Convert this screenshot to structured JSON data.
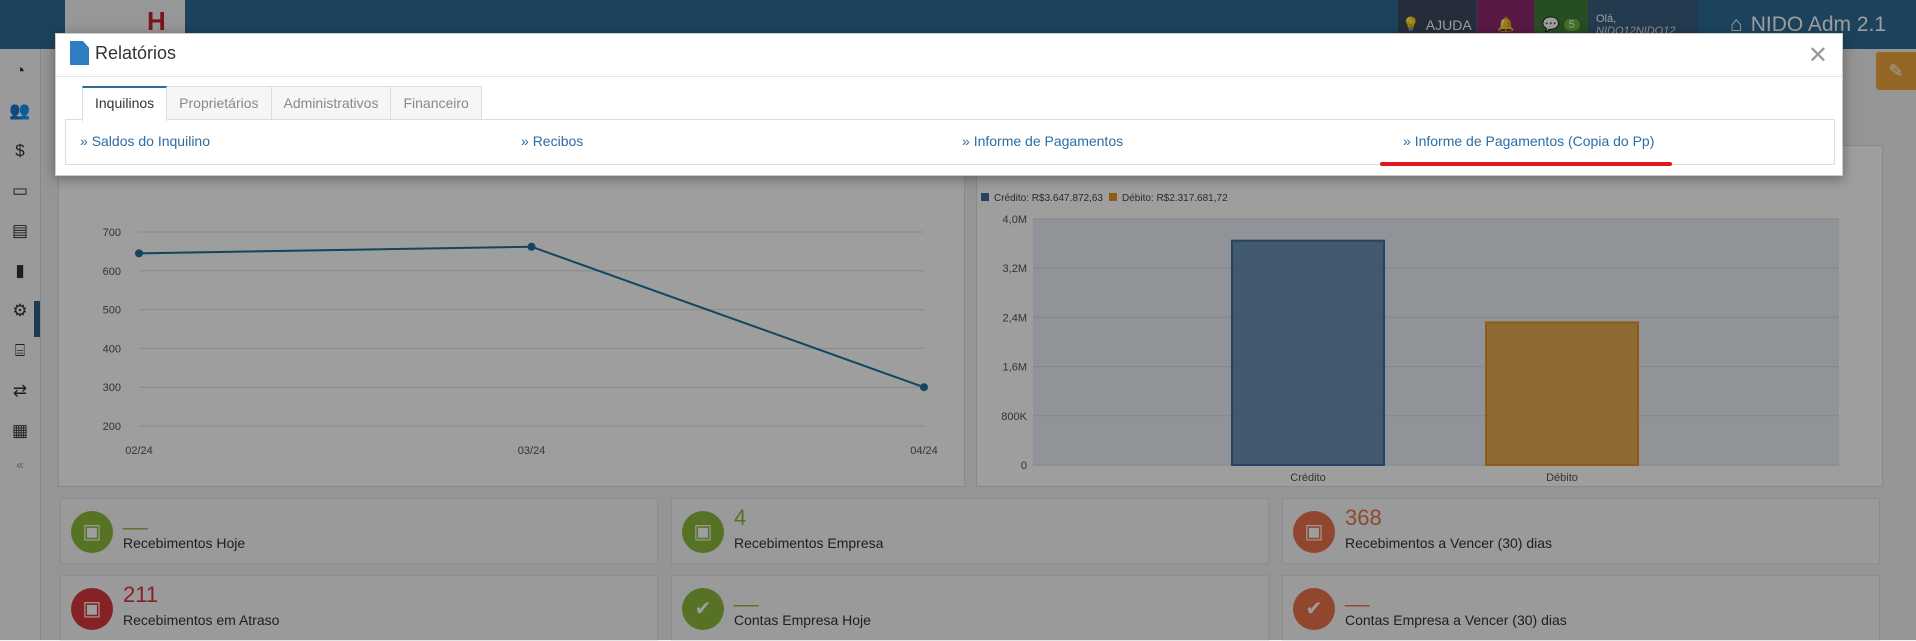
{
  "header": {
    "help_label": "AJUDA",
    "messages_count": "5",
    "greeting": "Olá,",
    "user_name": "NIDO12NIDO12",
    "brand": "NIDO Adm 2.1"
  },
  "modal": {
    "title": "Relatórios",
    "close_symbol": "✕",
    "tabs": [
      {
        "label": "Inquilinos",
        "active": true
      },
      {
        "label": "Proprietários",
        "active": false
      },
      {
        "label": "Administrativos",
        "active": false
      },
      {
        "label": "Financeiro",
        "active": false
      }
    ],
    "links": [
      {
        "label": "Saldos do Inquilino"
      },
      {
        "label": "Recibos"
      },
      {
        "label": "Informe de Pagamentos"
      },
      {
        "label": "Informe de Pagamentos (Copia do Pp)"
      }
    ]
  },
  "stats": [
    {
      "value": "__",
      "label": "Recebimentos Hoje",
      "color": "#8bb83b",
      "icon": "money-icon"
    },
    {
      "value": "4",
      "label": "Recebimentos Empresa",
      "color": "#8bb83b",
      "icon": "money-icon"
    },
    {
      "value": "368",
      "label": "Recebimentos a Vencer (30) dias",
      "color": "#e8734a",
      "icon": "money-icon"
    },
    {
      "value": "211",
      "label": "Recebimentos em Atraso",
      "color": "#d9363e",
      "icon": "money-icon"
    },
    {
      "value": "__",
      "label": "Contas Empresa Hoje",
      "color": "#8bb83b",
      "icon": "check-icon"
    },
    {
      "value": "__",
      "label": "Contas Empresa a Vencer (30) dias",
      "color": "#e8734a",
      "icon": "check-icon"
    }
  ],
  "chart_data": [
    {
      "type": "line",
      "categories": [
        "02/24",
        "03/24",
        "04/24"
      ],
      "values": [
        645,
        662,
        300
      ],
      "ylim": [
        200,
        700
      ],
      "yticks": [
        "200",
        "300",
        "400",
        "500",
        "600",
        "700"
      ],
      "color": "#1f6e9e"
    },
    {
      "type": "bar",
      "categories": [
        "Crédito",
        "Débito"
      ],
      "values": [
        3647872.63,
        2317681.72
      ],
      "legend": [
        "Crédito: R$3.647.872,63",
        "Débito: R$2.317.681,72"
      ],
      "ylim": [
        0,
        4000000
      ],
      "yticks": [
        "0",
        "800K",
        "1,6M",
        "2,4M",
        "3,2M",
        "4,0M"
      ],
      "colors": [
        "#3d6f9e",
        "#e8951f"
      ],
      "legend_position": "top-left"
    }
  ]
}
